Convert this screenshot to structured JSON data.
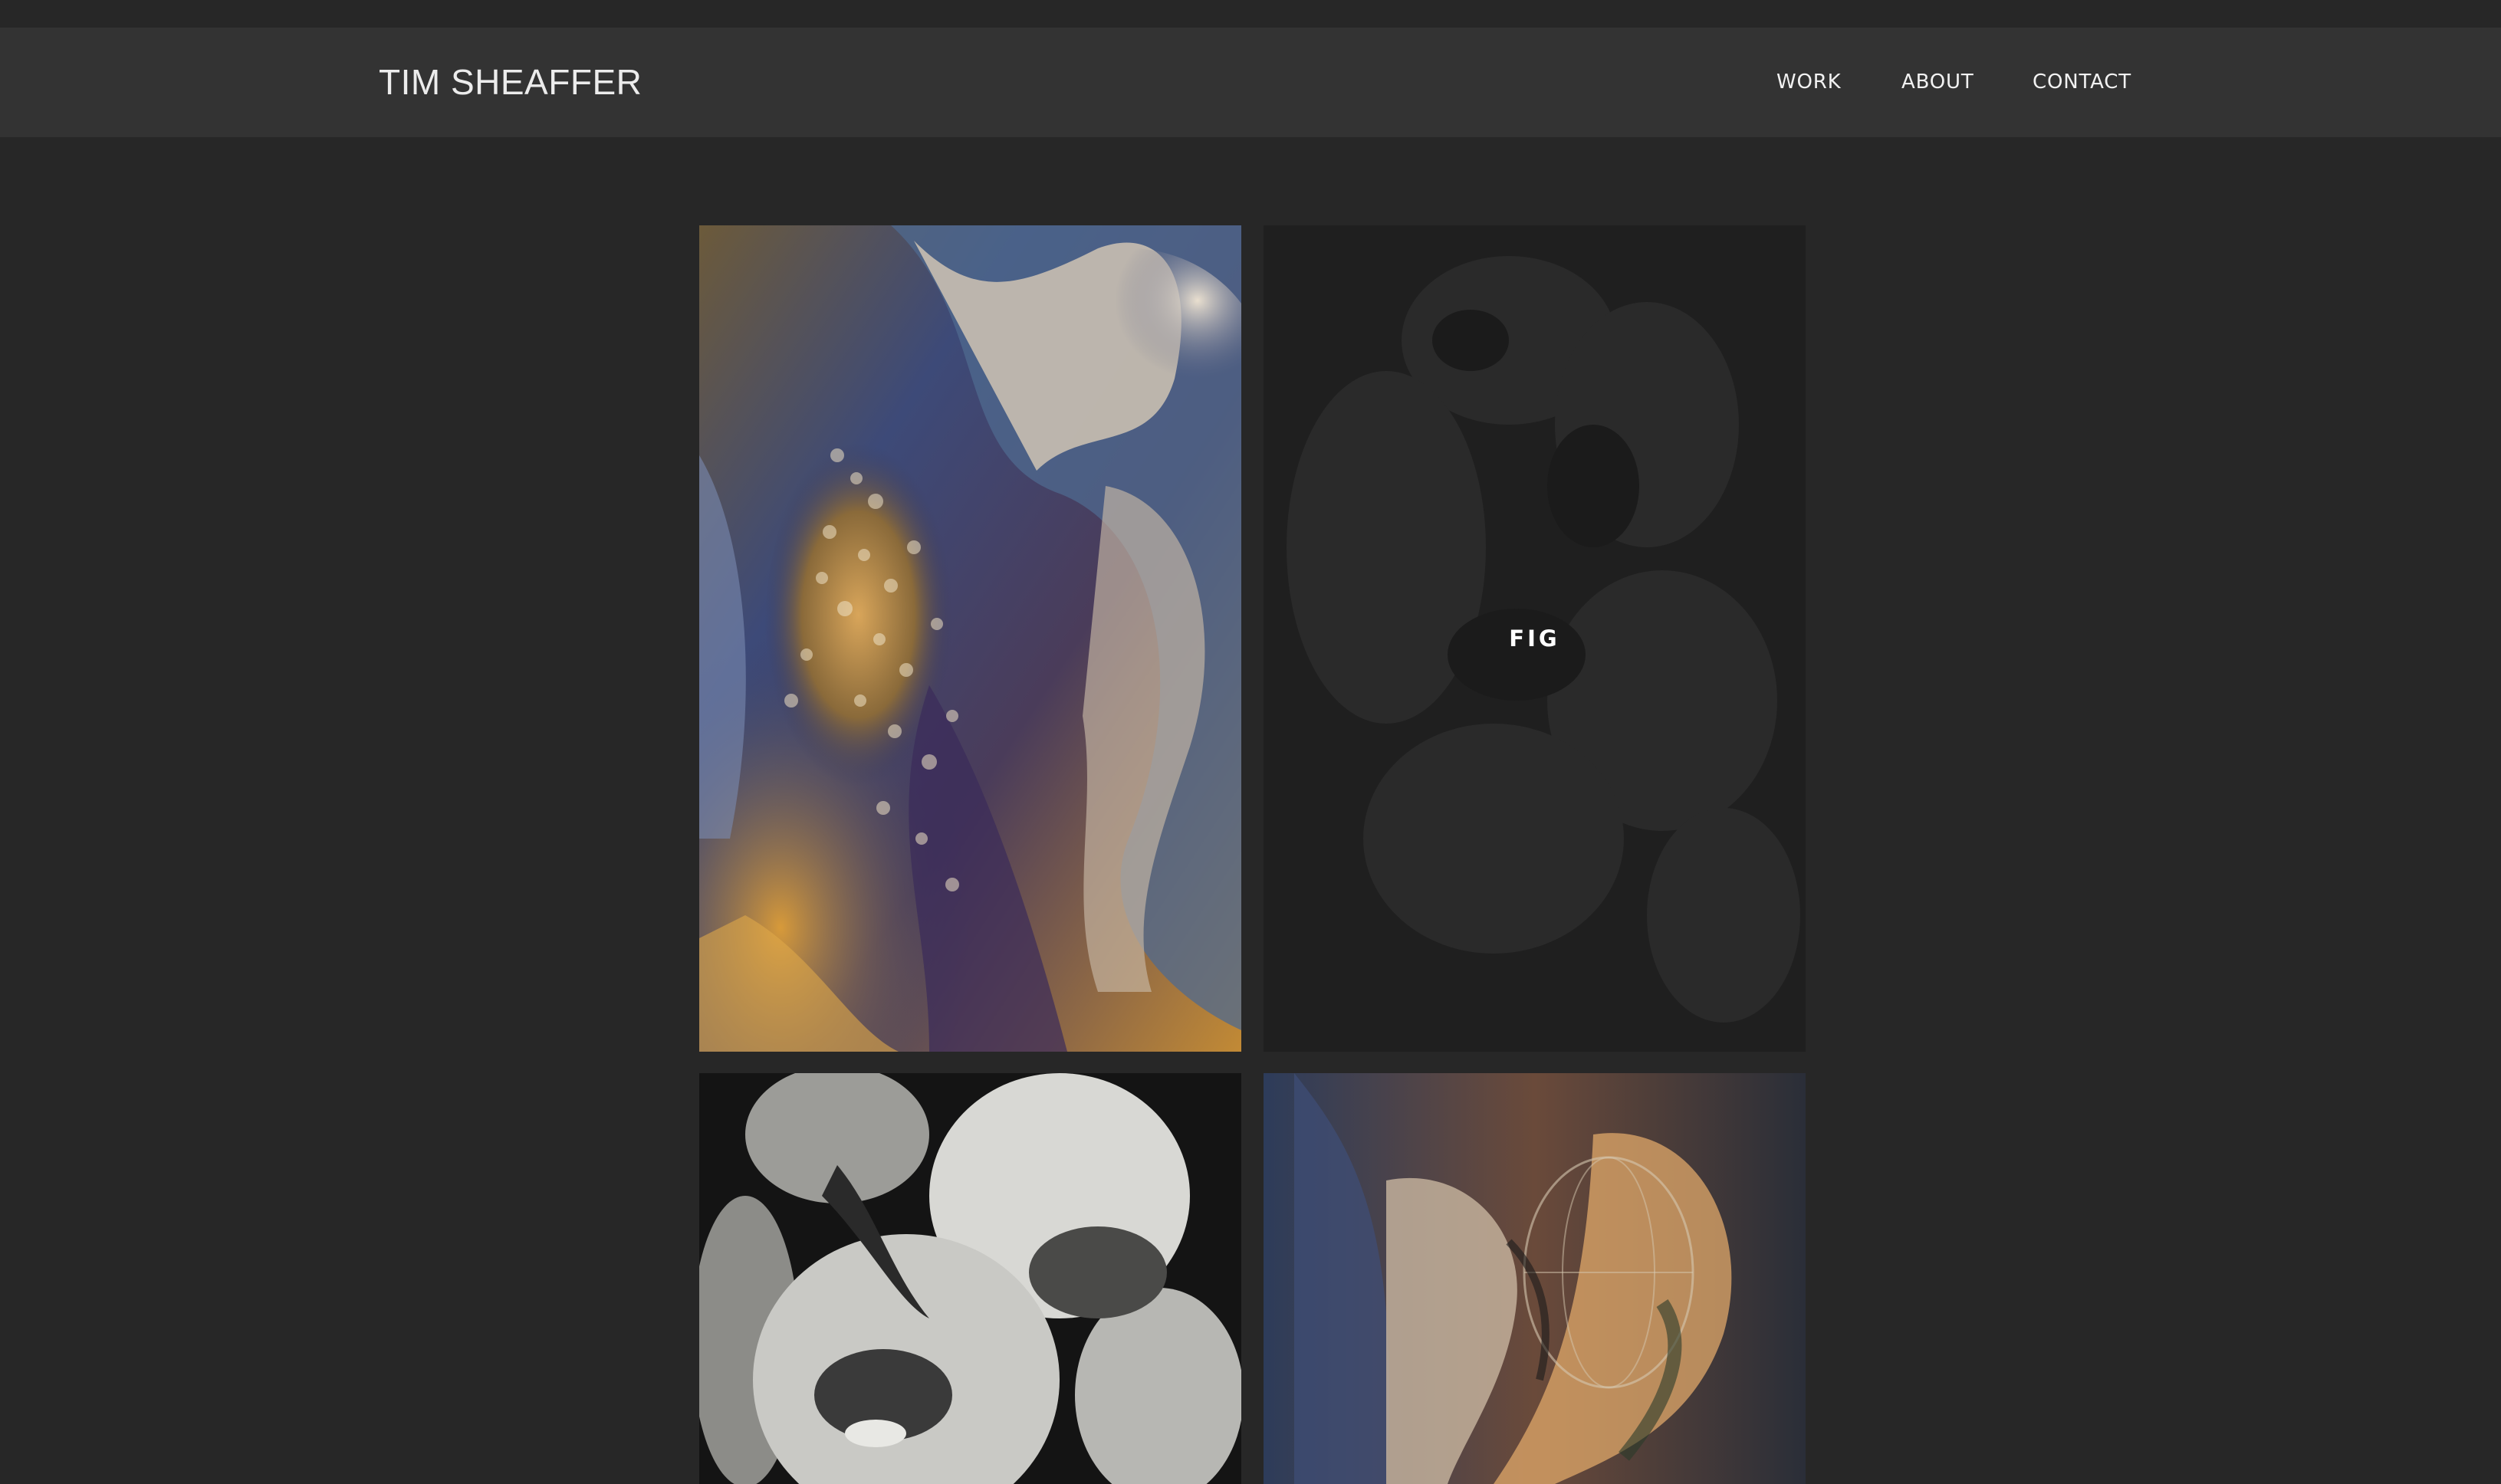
{
  "header": {
    "site_title": "TIM SHEAFFER",
    "nav": {
      "work": "WORK",
      "about": "ABOUT",
      "contact": "CONTACT"
    }
  },
  "gallery": {
    "tiles": [
      {
        "caption": "",
        "image": "colorful-abstract-figure-image"
      },
      {
        "caption": "FIG",
        "image": "dark-abstract-image"
      },
      {
        "caption": "",
        "image": "monochrome-abstract-face-image"
      },
      {
        "caption": "",
        "image": "colorful-abstract-torso-image"
      }
    ]
  },
  "colors": {
    "background": "#272727",
    "header_background": "#333333",
    "text": "#ececec"
  }
}
